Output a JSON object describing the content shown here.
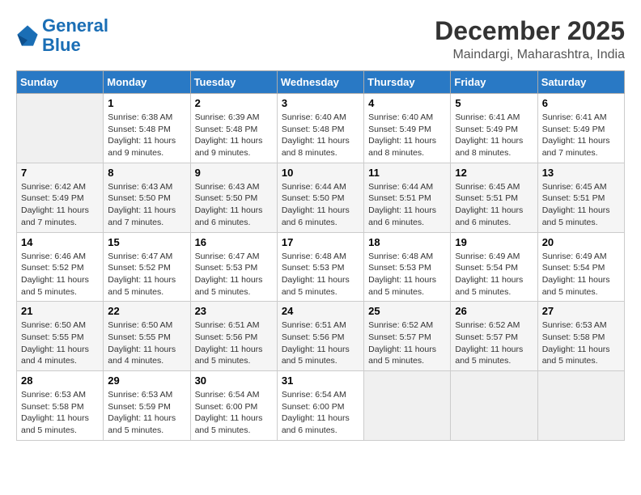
{
  "header": {
    "logo_line1": "General",
    "logo_line2": "Blue",
    "month": "December 2025",
    "location": "Maindargi, Maharashtra, India"
  },
  "days_of_week": [
    "Sunday",
    "Monday",
    "Tuesday",
    "Wednesday",
    "Thursday",
    "Friday",
    "Saturday"
  ],
  "weeks": [
    [
      {
        "day": "",
        "info": ""
      },
      {
        "day": "1",
        "info": "Sunrise: 6:38 AM\nSunset: 5:48 PM\nDaylight: 11 hours and 9 minutes."
      },
      {
        "day": "2",
        "info": "Sunrise: 6:39 AM\nSunset: 5:48 PM\nDaylight: 11 hours and 9 minutes."
      },
      {
        "day": "3",
        "info": "Sunrise: 6:40 AM\nSunset: 5:48 PM\nDaylight: 11 hours and 8 minutes."
      },
      {
        "day": "4",
        "info": "Sunrise: 6:40 AM\nSunset: 5:49 PM\nDaylight: 11 hours and 8 minutes."
      },
      {
        "day": "5",
        "info": "Sunrise: 6:41 AM\nSunset: 5:49 PM\nDaylight: 11 hours and 8 minutes."
      },
      {
        "day": "6",
        "info": "Sunrise: 6:41 AM\nSunset: 5:49 PM\nDaylight: 11 hours and 7 minutes."
      }
    ],
    [
      {
        "day": "7",
        "info": "Sunrise: 6:42 AM\nSunset: 5:49 PM\nDaylight: 11 hours and 7 minutes."
      },
      {
        "day": "8",
        "info": "Sunrise: 6:43 AM\nSunset: 5:50 PM\nDaylight: 11 hours and 7 minutes."
      },
      {
        "day": "9",
        "info": "Sunrise: 6:43 AM\nSunset: 5:50 PM\nDaylight: 11 hours and 6 minutes."
      },
      {
        "day": "10",
        "info": "Sunrise: 6:44 AM\nSunset: 5:50 PM\nDaylight: 11 hours and 6 minutes."
      },
      {
        "day": "11",
        "info": "Sunrise: 6:44 AM\nSunset: 5:51 PM\nDaylight: 11 hours and 6 minutes."
      },
      {
        "day": "12",
        "info": "Sunrise: 6:45 AM\nSunset: 5:51 PM\nDaylight: 11 hours and 6 minutes."
      },
      {
        "day": "13",
        "info": "Sunrise: 6:45 AM\nSunset: 5:51 PM\nDaylight: 11 hours and 5 minutes."
      }
    ],
    [
      {
        "day": "14",
        "info": "Sunrise: 6:46 AM\nSunset: 5:52 PM\nDaylight: 11 hours and 5 minutes."
      },
      {
        "day": "15",
        "info": "Sunrise: 6:47 AM\nSunset: 5:52 PM\nDaylight: 11 hours and 5 minutes."
      },
      {
        "day": "16",
        "info": "Sunrise: 6:47 AM\nSunset: 5:53 PM\nDaylight: 11 hours and 5 minutes."
      },
      {
        "day": "17",
        "info": "Sunrise: 6:48 AM\nSunset: 5:53 PM\nDaylight: 11 hours and 5 minutes."
      },
      {
        "day": "18",
        "info": "Sunrise: 6:48 AM\nSunset: 5:53 PM\nDaylight: 11 hours and 5 minutes."
      },
      {
        "day": "19",
        "info": "Sunrise: 6:49 AM\nSunset: 5:54 PM\nDaylight: 11 hours and 5 minutes."
      },
      {
        "day": "20",
        "info": "Sunrise: 6:49 AM\nSunset: 5:54 PM\nDaylight: 11 hours and 5 minutes."
      }
    ],
    [
      {
        "day": "21",
        "info": "Sunrise: 6:50 AM\nSunset: 5:55 PM\nDaylight: 11 hours and 4 minutes."
      },
      {
        "day": "22",
        "info": "Sunrise: 6:50 AM\nSunset: 5:55 PM\nDaylight: 11 hours and 4 minutes."
      },
      {
        "day": "23",
        "info": "Sunrise: 6:51 AM\nSunset: 5:56 PM\nDaylight: 11 hours and 5 minutes."
      },
      {
        "day": "24",
        "info": "Sunrise: 6:51 AM\nSunset: 5:56 PM\nDaylight: 11 hours and 5 minutes."
      },
      {
        "day": "25",
        "info": "Sunrise: 6:52 AM\nSunset: 5:57 PM\nDaylight: 11 hours and 5 minutes."
      },
      {
        "day": "26",
        "info": "Sunrise: 6:52 AM\nSunset: 5:57 PM\nDaylight: 11 hours and 5 minutes."
      },
      {
        "day": "27",
        "info": "Sunrise: 6:53 AM\nSunset: 5:58 PM\nDaylight: 11 hours and 5 minutes."
      }
    ],
    [
      {
        "day": "28",
        "info": "Sunrise: 6:53 AM\nSunset: 5:58 PM\nDaylight: 11 hours and 5 minutes."
      },
      {
        "day": "29",
        "info": "Sunrise: 6:53 AM\nSunset: 5:59 PM\nDaylight: 11 hours and 5 minutes."
      },
      {
        "day": "30",
        "info": "Sunrise: 6:54 AM\nSunset: 6:00 PM\nDaylight: 11 hours and 5 minutes."
      },
      {
        "day": "31",
        "info": "Sunrise: 6:54 AM\nSunset: 6:00 PM\nDaylight: 11 hours and 6 minutes."
      },
      {
        "day": "",
        "info": ""
      },
      {
        "day": "",
        "info": ""
      },
      {
        "day": "",
        "info": ""
      }
    ]
  ]
}
